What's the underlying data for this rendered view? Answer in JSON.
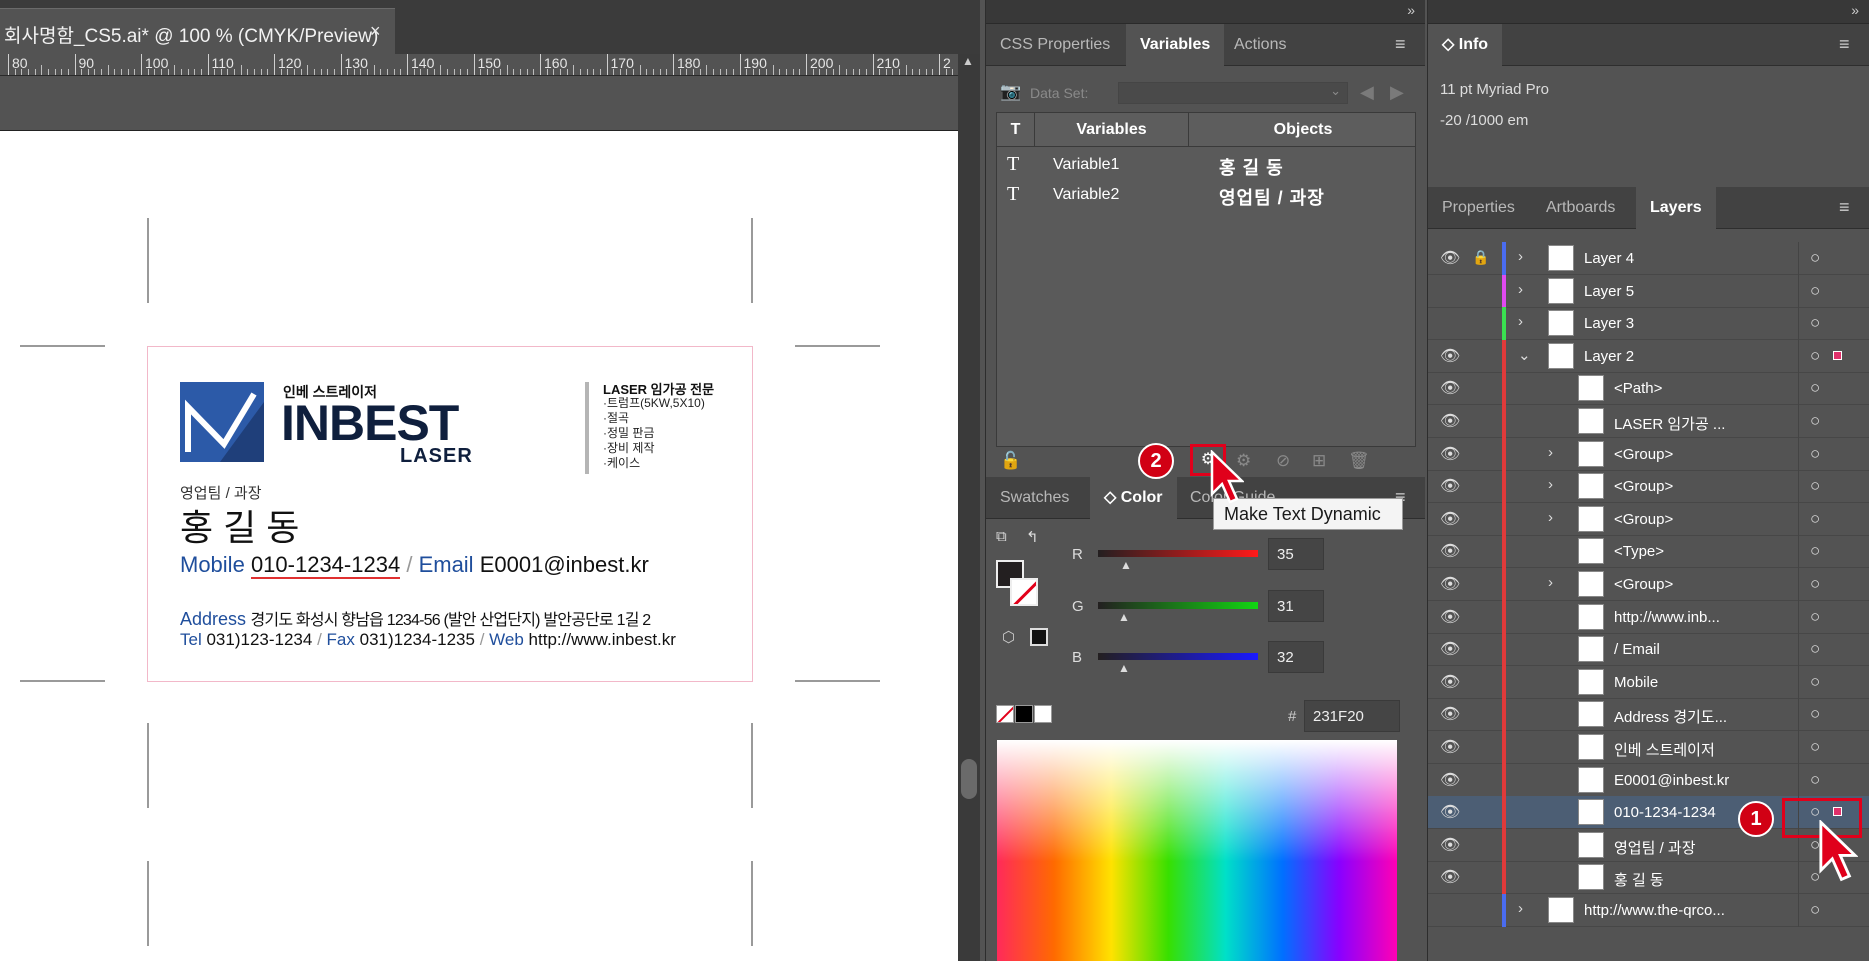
{
  "document": {
    "tab_title": "회사명함_CS5.ai* @ 100 % (CMYK/Preview)",
    "close": "×",
    "ruler_labels": [
      "80",
      "90",
      "100",
      "110",
      "120",
      "130",
      "140",
      "150",
      "160",
      "170",
      "180",
      "190",
      "200",
      "210",
      "2"
    ]
  },
  "card": {
    "brand_small": "인베 스트레이저",
    "brand_big": "INBEST",
    "brand_sub": "LASER",
    "service_title": "LASER 임가공 전문",
    "services": [
      "·트럼프(5KW,5X10)",
      "·절곡",
      "·정밀 판금",
      "·장비 제작",
      "·케이스"
    ],
    "department": "영업팀 / 과장",
    "name": "홍 길 동",
    "mobile_label": "Mobile",
    "mobile": "010-1234-1234",
    "email_label": "Email",
    "email": "E0001@inbest.kr",
    "sep": "/",
    "address_label": "Address",
    "address": "경기도 화성시 향남읍 1234-56 (발안 산업단지) 발안공단로 1길 2",
    "tel_label": "Tel",
    "tel": "031)123-1234",
    "fax_label": "Fax",
    "fax": "031)1234-1235",
    "web_label": "Web",
    "web": "http://www.inbest.kr"
  },
  "panel1": {
    "tabs": [
      "CSS Properties",
      "Variables",
      "Actions"
    ],
    "active_tab": "Variables",
    "dataset_label": "Data Set:",
    "columns": [
      "T",
      "Variables",
      "Objects"
    ],
    "rows": [
      {
        "type": "T",
        "name": "Variable1",
        "object": "홍 길 동"
      },
      {
        "type": "T",
        "name": "Variable2",
        "object": "영업팀 / 과장"
      }
    ],
    "color_tabs": [
      "Swatches",
      "Color",
      "Color Guide"
    ],
    "color_active": "Color",
    "channels": [
      {
        "ch": "R",
        "value": "35",
        "color": "#ff2020"
      },
      {
        "ch": "G",
        "value": "31",
        "color": "#10d010"
      },
      {
        "ch": "B",
        "value": "32",
        "color": "#2020ff"
      }
    ],
    "hex_label": "#",
    "hex": "231F20"
  },
  "tooltip": "Make Text Dynamic",
  "panel2": {
    "info_tab": "Info",
    "info_lines": [
      "11 pt Myriad Pro",
      "-20 /1000 em"
    ],
    "tabs": [
      "Properties",
      "Artboards",
      "Layers"
    ],
    "active_tab": "Layers",
    "layers": [
      {
        "name": "Layer 4",
        "visible": true,
        "locked": true,
        "color": "#4a6cf0",
        "arrow": "›",
        "indent": 0
      },
      {
        "name": "Layer 5",
        "visible": false,
        "locked": false,
        "color": "#e04af0",
        "arrow": "›",
        "indent": 0
      },
      {
        "name": "Layer 3",
        "visible": false,
        "locked": false,
        "color": "#3ae050",
        "arrow": "›",
        "indent": 0
      },
      {
        "name": "Layer 2",
        "visible": true,
        "locked": false,
        "color": "#e03a3a",
        "arrow": "⌄",
        "indent": 0
      },
      {
        "name": "<Path>",
        "visible": true,
        "color": "#e03a3a",
        "arrow": "",
        "indent": 1
      },
      {
        "name": "LASER 임가공 ...",
        "visible": true,
        "color": "#e03a3a",
        "arrow": "",
        "indent": 1
      },
      {
        "name": "<Group>",
        "visible": true,
        "color": "#e03a3a",
        "arrow": "›",
        "indent": 1
      },
      {
        "name": "<Group>",
        "visible": true,
        "color": "#e03a3a",
        "arrow": "›",
        "indent": 1
      },
      {
        "name": "<Group>",
        "visible": true,
        "color": "#e03a3a",
        "arrow": "›",
        "indent": 1
      },
      {
        "name": "<Type>",
        "visible": true,
        "color": "#e03a3a",
        "arrow": "",
        "indent": 1
      },
      {
        "name": "<Group>",
        "visible": true,
        "color": "#e03a3a",
        "arrow": "›",
        "indent": 1
      },
      {
        "name": "http://www.inb...",
        "visible": true,
        "color": "#e03a3a",
        "arrow": "",
        "indent": 1
      },
      {
        "name": "/ Email",
        "visible": true,
        "color": "#e03a3a",
        "arrow": "",
        "indent": 1
      },
      {
        "name": "Mobile",
        "visible": true,
        "color": "#e03a3a",
        "arrow": "",
        "indent": 1
      },
      {
        "name": "Address 경기도...",
        "visible": true,
        "color": "#e03a3a",
        "arrow": "",
        "indent": 1
      },
      {
        "name": "인베 스트레이저",
        "visible": true,
        "color": "#e03a3a",
        "arrow": "",
        "indent": 1
      },
      {
        "name": "E0001@inbest.kr",
        "visible": true,
        "color": "#e03a3a",
        "arrow": "",
        "indent": 1
      },
      {
        "name": "010-1234-1234",
        "visible": true,
        "color": "#e03a3a",
        "arrow": "",
        "indent": 1,
        "selected": true
      },
      {
        "name": "영업팀 / 과장",
        "visible": true,
        "color": "#e03a3a",
        "arrow": "",
        "indent": 1
      },
      {
        "name": "홍 길 동",
        "visible": true,
        "color": "#e03a3a",
        "arrow": "",
        "indent": 1
      },
      {
        "name": "http://www.the-qrco...",
        "visible": false,
        "color": "#4a6cf0",
        "arrow": "›",
        "indent": 0
      }
    ]
  },
  "badges": [
    "1",
    "2"
  ],
  "colors": {
    "accent_red": "#e0001b",
    "brand_blue": "#1f4e9c",
    "selection": "#4c5e74"
  }
}
